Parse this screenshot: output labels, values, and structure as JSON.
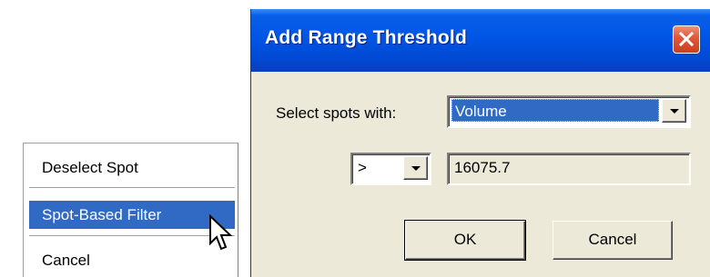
{
  "context_menu": {
    "items": [
      {
        "label": "Deselect Spot"
      },
      {
        "label": "Spot-Based Filter",
        "highlighted": true
      },
      {
        "label": "Cancel"
      }
    ]
  },
  "dialog": {
    "title": "Add Range Threshold",
    "select_label": "Select spots with:",
    "attribute_select": {
      "value": "Volume"
    },
    "operator_select": {
      "value": ">"
    },
    "threshold_value": "16075.7",
    "ok_label": "OK",
    "cancel_label": "Cancel"
  },
  "colors": {
    "highlight": "#316ac5",
    "titlebar": "#0055e5",
    "dialog_bg": "#ece9d8",
    "close_button": "#e05a3a"
  },
  "icons": {
    "close": "close-icon",
    "dropdown": "chevron-down-icon",
    "pointer": "mouse-pointer-icon"
  }
}
